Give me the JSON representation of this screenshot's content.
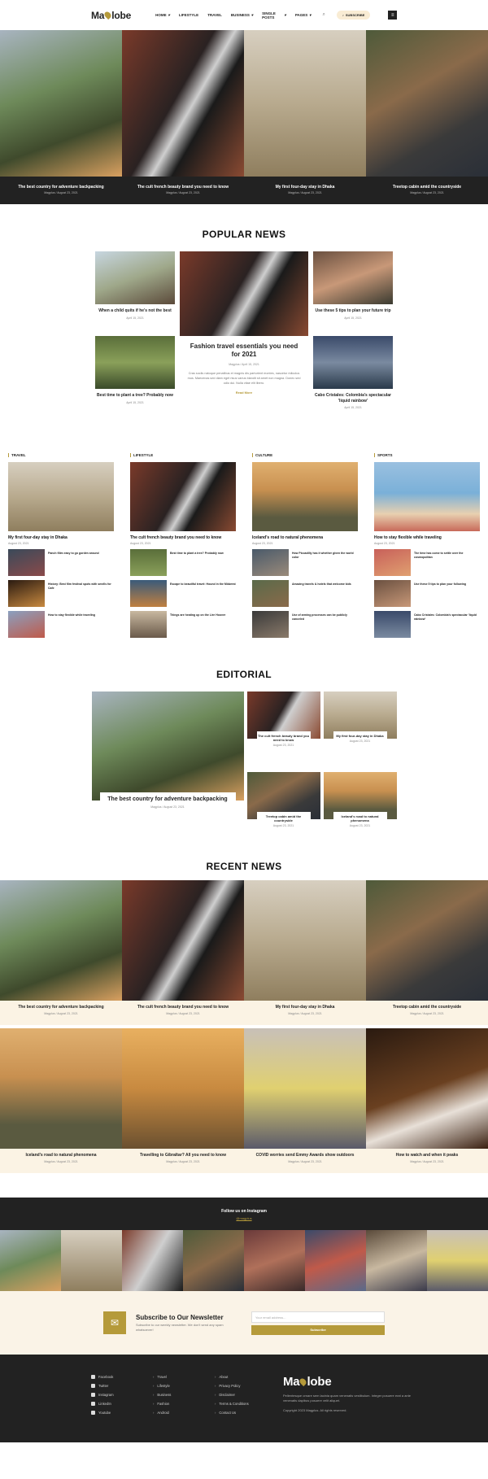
{
  "header": {
    "logo_left": "Ma",
    "logo_right": "lobe",
    "nav": [
      "HOME",
      "LIFESTYLE",
      "TRAVEL",
      "BUSINESS",
      "SINGLE POSTS",
      "PAGES"
    ],
    "subscribe": "SUBSCRIBE"
  },
  "hero": [
    {
      "title": "The best country for adventure backpacking",
      "meta": "Magplus / August 23, 2021"
    },
    {
      "title": "The cult french beauty brand you need to know",
      "meta": "Magplus / August 23, 2021"
    },
    {
      "title": "My first four-day stay in Dhaka",
      "meta": "Magplus / August 23, 2021"
    },
    {
      "title": "Treetop cabin amid the countryside",
      "meta": "Magplus / August 23, 2021"
    }
  ],
  "popular": {
    "heading": "POPULAR NEWS",
    "left": [
      {
        "title": "When a child quits if he's not the best",
        "meta": "April 15, 2021"
      },
      {
        "title": "Best time to plant a tree? Probably now",
        "meta": "April 15, 2021"
      }
    ],
    "featured": {
      "title": "Fashion travel essentials you need for 2021",
      "meta": "Magplus / April 15, 2021",
      "excerpt": "Cras sociis natoque penatibus et magnis dis parturient montes, nascetur ridiculus mus. Maecenas sed diam eget risus varius blandit sit amet non magna. Donec sed odio dui. Nulla vitae elit libero.",
      "link": "Read More"
    },
    "right": [
      {
        "title": "Use these 5 tips to plan your future trip",
        "meta": "April 15, 2021"
      },
      {
        "title": "Cabo Cristales: Colombia's spectacular 'liquid rainbow'",
        "meta": "April 15, 2021"
      }
    ]
  },
  "categories": [
    {
      "label": "TRAVEL",
      "big": "My first four-day stay in Dhaka",
      "meta": "August 23, 2021",
      "items": [
        "Panch filim easy to go gorden around",
        "History: Best film festival spots with smells for Cafe",
        "How to stay flexible while traveling"
      ]
    },
    {
      "label": "LIFESTYLE",
      "big": "The cult french beauty brand you need to know",
      "meta": "August 23, 2021",
      "items": [
        "Best time to plant a tree? Probably now",
        "Escape to beautiful travel: Hound in the Midwest",
        "Things are heating up on the Lire Hoover"
      ]
    },
    {
      "label": "CULTURE",
      "big": "Iceland's road to natural phenomena",
      "meta": "August 23, 2021",
      "items": [
        "How Piccadilly has it whether given the world color",
        "Amazing travels & hotels that welcome kids",
        "Use of arming processes can be publicly canceled"
      ]
    },
    {
      "label": "SPORTS",
      "big": "How to stay flexible while traveling",
      "meta": "August 23, 2021",
      "items": [
        "The time has come to settle over the cosmopolitan",
        "Use these 5 tips to plan your following",
        "Cabo Cristales: Colombia's spectacular 'liquid rainbow'"
      ]
    }
  ],
  "editorial": {
    "heading": "EDITORIAL",
    "main": {
      "title": "The best country for adventure backpacking",
      "meta": "Magplus / August 23, 2021"
    },
    "grid": [
      {
        "title": "The cult french beauty brand you need to know",
        "meta": "August 23, 2021"
      },
      {
        "title": "My first four-day stay in Dhaka",
        "meta": "August 23, 2021"
      },
      {
        "title": "Treetop cabin amid the countryside",
        "meta": "August 23, 2021"
      },
      {
        "title": "Iceland's road to natural phenomena",
        "meta": "August 23, 2021"
      }
    ]
  },
  "recent": {
    "heading": "RECENT NEWS",
    "items": [
      {
        "title": "The best country for adventure backpacking",
        "meta": "Magplus / August 23, 2021"
      },
      {
        "title": "The cult french beauty brand you need to know",
        "meta": "Magplus / August 23, 2021"
      },
      {
        "title": "My first four-day stay in Dhaka",
        "meta": "Magplus / August 23, 2021"
      },
      {
        "title": "Treetop cabin amid the countryside",
        "meta": "Magplus / August 23, 2021"
      },
      {
        "title": "Iceland's road to natural phenomena",
        "meta": "Magplus / August 23, 2021"
      },
      {
        "title": "Travelling to Gibraltar? All you need to know",
        "meta": "Magplus / August 23, 2021"
      },
      {
        "title": "COVID worries send Emmy Awards show outdoors",
        "meta": "Magplus / August 23, 2021"
      },
      {
        "title": "How to watch and when it peaks",
        "meta": "Magplus / August 23, 2021"
      }
    ]
  },
  "instagram": {
    "title": "Follow us on Instagram",
    "handle": "@magplus"
  },
  "newsletter": {
    "title": "Subscribe to Our Newsletter",
    "subtitle": "Subscribe to our weekly newsletter. We don't send any spam whatsoever!",
    "placeholder": "Your email address...",
    "button": "Subscribe"
  },
  "footer": {
    "social": [
      "Facebook",
      "Twitter",
      "Instagram",
      "LinkedIn",
      "Youtube"
    ],
    "cats": [
      "Travel",
      "Lifestyle",
      "Business",
      "Fashion",
      "Android"
    ],
    "links": [
      "About",
      "Privacy Policy",
      "Disclaimer",
      "Terms & Conditions",
      "Contact Us"
    ],
    "brand_left": "Ma",
    "brand_right": "lobe",
    "desc": "Pellentesque ornare sem lacinia quam venenatis vestibulum. Integer posuere erat a ante venenatis dapibus posuere velit aliquet.",
    "copy": "Copyright 2023 Magplus. All rights reserved."
  },
  "colors": {
    "accent": "#b59a3a",
    "dark": "#222222",
    "cream": "#faf3e7"
  }
}
